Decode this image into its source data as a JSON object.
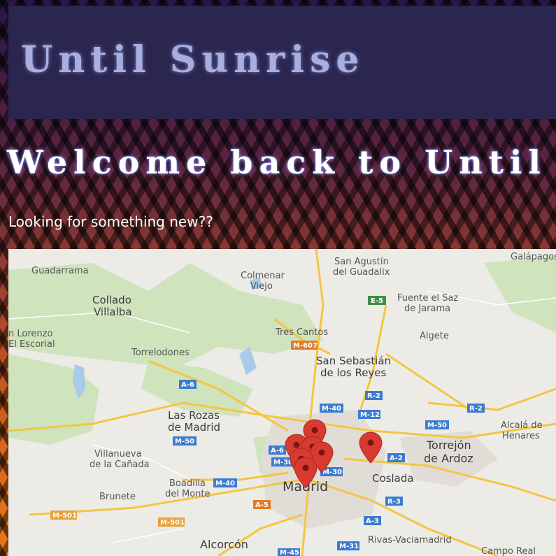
{
  "header": {
    "site_title": "Until Sunrise"
  },
  "hero": {
    "welcome": "Welcome back to Until",
    "subtitle": "Looking for something new??"
  },
  "map": {
    "places": {
      "guadarrama": "Guadarrama",
      "colmenar_1": "Colmenar",
      "colmenar_2": "Viejo",
      "san_agustin_1": "San Agustín",
      "san_agustin_2": "del Guadalix",
      "galapagos": "Galápagos",
      "collado_1": "Collado",
      "collado_2": "Villalba",
      "fuente_1": "Fuente el Saz",
      "fuente_2": "de Jarama",
      "lorenzo_1": "n Lorenzo",
      "lorenzo_2": "El Escorial",
      "tres_cantos": "Tres Cantos",
      "algete": "Algete",
      "torrelodones": "Torrelodones",
      "sanse_1": "San Sebastián",
      "sanse_2": "de los Reyes",
      "rozas_1": "Las Rozas",
      "rozas_2": "de Madrid",
      "alcala_1": "Alcalá de",
      "alcala_2": "Henares",
      "torrejon_1": "Torrejón",
      "torrejon_2": "de Ardoz",
      "villanueva_1": "Villanueva",
      "villanueva_2": "de la Cañada",
      "coslada": "Coslada",
      "boadilla_1": "Boadilla",
      "boadilla_2": "del Monte",
      "madrid": "Madrid",
      "brunete": "Brunete",
      "alcorcon": "Alcorcón",
      "rivas": "Rivas-Vaciamadrid",
      "campo_real": "Campo Real"
    },
    "roads": {
      "e5": "E-5",
      "m607": "M-607",
      "a6_1": "A-6",
      "a6_2": "A-6",
      "m40_1": "M-40",
      "m40_2": "M-40",
      "r2_1": "R-2",
      "r2_2": "R-2",
      "m12": "M-12",
      "m50_1": "M-50",
      "m50_2": "M-50",
      "m30_1": "M-30",
      "m30_2": "M-30",
      "a2": "A-2",
      "a5": "A-5",
      "r3": "R-3",
      "a3": "A-3",
      "m501_1": "M-501",
      "m501_2": "M-501",
      "m31": "M-31",
      "m45": "M-45"
    },
    "colors": {
      "marker": "#d93a30",
      "road": "#f5c542",
      "park": "#c8dfb4",
      "water": "#a9cbe8"
    }
  }
}
